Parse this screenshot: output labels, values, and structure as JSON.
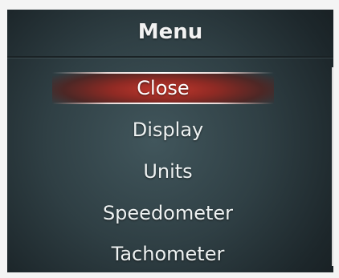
{
  "menu": {
    "title": "Menu",
    "items": [
      {
        "label": "Close",
        "selected": true
      },
      {
        "label": "Display",
        "selected": false
      },
      {
        "label": "Units",
        "selected": false
      },
      {
        "label": "Speedometer",
        "selected": false
      },
      {
        "label": "Tachometer",
        "selected": false
      }
    ]
  },
  "colors": {
    "highlight": "#c2372c",
    "background": "#2f3f44",
    "text": "#eef2f2"
  }
}
